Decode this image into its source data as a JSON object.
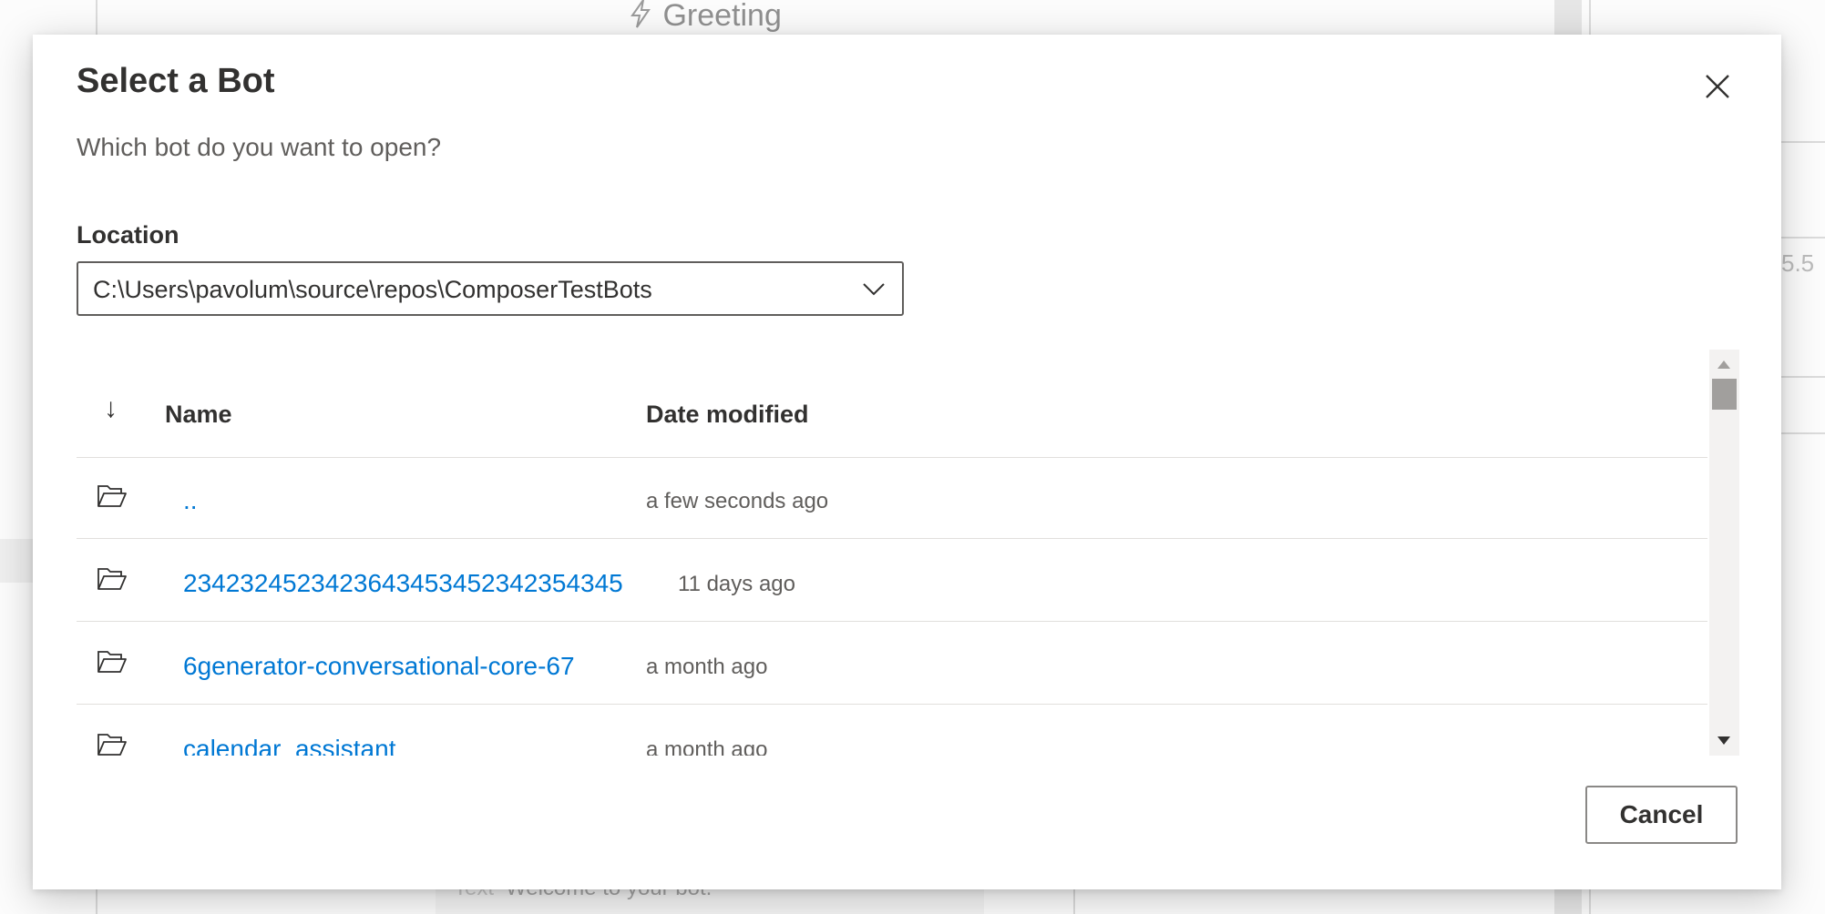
{
  "background": {
    "trigger_title": "Greeting",
    "right_value": "5.5",
    "footer_prefix": "Text",
    "footer_text": "Welcome to your bot."
  },
  "dialog": {
    "title": "Select a Bot",
    "subtitle": "Which bot do you want to open?",
    "close_icon": "close-icon"
  },
  "location": {
    "label": "Location",
    "value": "C:\\Users\\pavolum\\source\\repos\\ComposerTestBots",
    "icon": "chevron-down-icon"
  },
  "list": {
    "sort_icon": "↓",
    "columns": {
      "name": "Name",
      "date": "Date modified"
    },
    "rows": [
      {
        "name": "..",
        "date": "a few seconds ago",
        "icon": "folder-open-icon"
      },
      {
        "name": "2342324523423643453452342354345",
        "date": "11 days ago",
        "icon": "folder-open-icon"
      },
      {
        "name": "6generator-conversational-core-67",
        "date": "a month ago",
        "icon": "folder-open-icon"
      },
      {
        "name": "calendar_assistant",
        "date": "a month ago",
        "icon": "folder-open-icon"
      }
    ]
  },
  "actions": {
    "cancel_label": "Cancel"
  },
  "colors": {
    "link": "#0078d4",
    "text": "#323130",
    "muted": "#605e5c"
  }
}
